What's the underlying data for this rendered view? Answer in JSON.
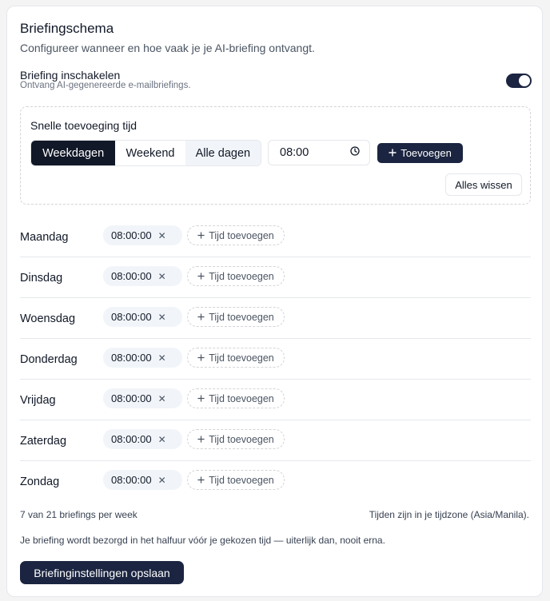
{
  "header": {
    "title": "Briefingschema",
    "description": "Configureer wanneer en hoe vaak je je AI-briefing ontvangt."
  },
  "enable": {
    "label": "Briefing inschakelen",
    "sublabel": "Ontvang AI-gegenereerde e-mailbriefings.",
    "on": true
  },
  "quick_add": {
    "title": "Snelle toevoeging tijd",
    "segments": [
      "Weekdagen",
      "Weekend",
      "Alle dagen"
    ],
    "selected": "Weekdagen",
    "time_value": "08:00",
    "add_label": "Toevoegen",
    "clear_label": "Alles wissen"
  },
  "days": [
    {
      "name": "Maandag",
      "times": [
        "08:00:00"
      ]
    },
    {
      "name": "Dinsdag",
      "times": [
        "08:00:00"
      ]
    },
    {
      "name": "Woensdag",
      "times": [
        "08:00:00"
      ]
    },
    {
      "name": "Donderdag",
      "times": [
        "08:00:00"
      ]
    },
    {
      "name": "Vrijdag",
      "times": [
        "08:00:00"
      ]
    },
    {
      "name": "Zaterdag",
      "times": [
        "08:00:00"
      ]
    },
    {
      "name": "Zondag",
      "times": [
        "08:00:00"
      ]
    }
  ],
  "add_time_label": "Tijd toevoegen",
  "footer": {
    "count": "7 van 21 briefings per week",
    "timezone": "Tijden zijn in je tijdzone (Asia/Manila).",
    "note": "Je briefing wordt bezorgd in het halfuur vóór je gekozen tijd — uiterlijk dan, nooit erna.",
    "save_label": "Briefinginstellingen opslaan"
  },
  "colors": {
    "primary": "#1b2541",
    "muted_bg": "#f1f5f9",
    "border": "#e5e7eb"
  }
}
